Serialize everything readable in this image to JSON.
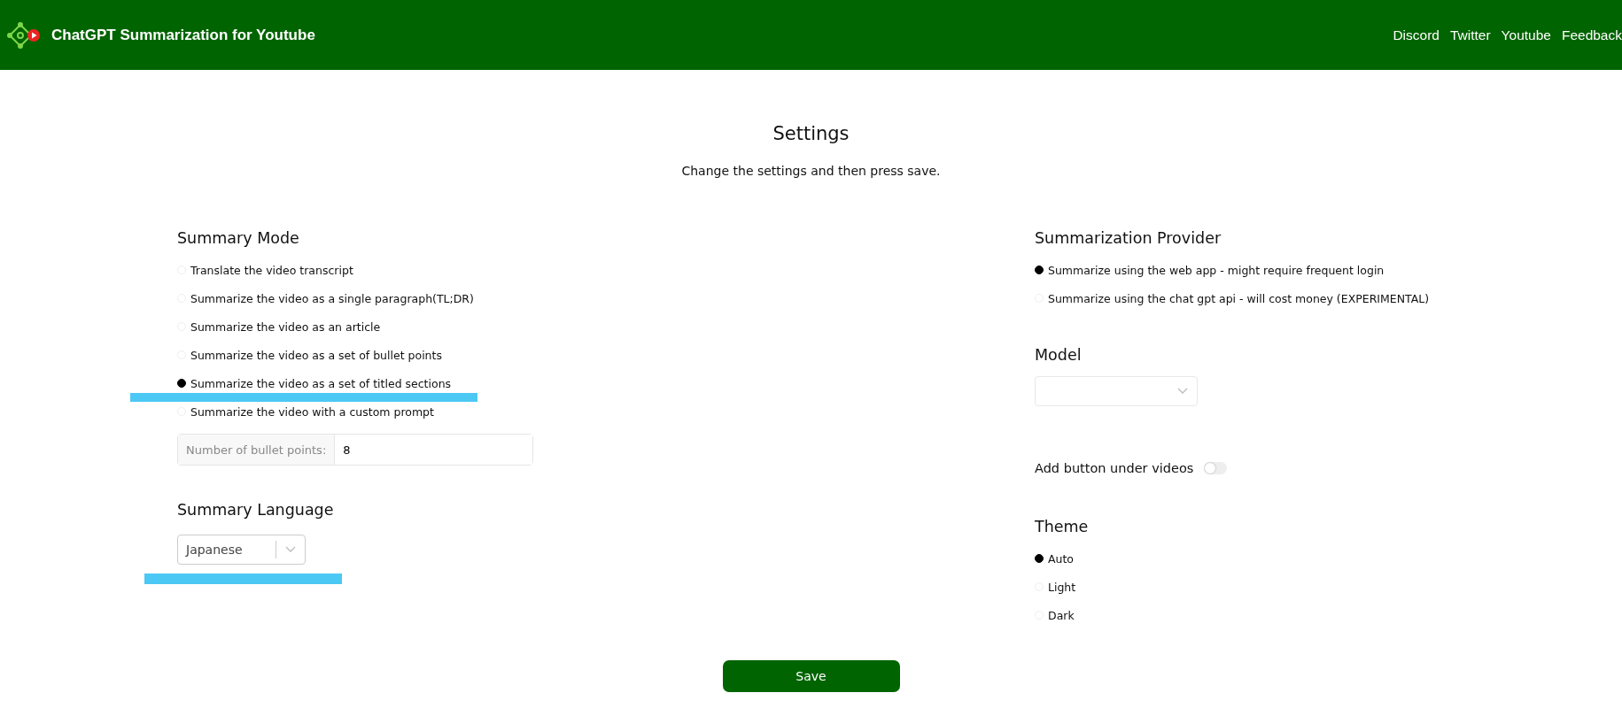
{
  "header": {
    "title": "ChatGPT Summarization for Youtube",
    "nav_links": [
      "Discord",
      "Twitter",
      "Youtube",
      "Feedback"
    ]
  },
  "settings": {
    "title": "Settings",
    "subtitle": "Change the settings and then press save."
  },
  "summary_mode": {
    "heading": "Summary Mode",
    "options": [
      {
        "label": "Translate the video transcript",
        "selected": false
      },
      {
        "label": "Summarize the video as a single paragraph(TL;DR)",
        "selected": false
      },
      {
        "label": "Summarize the video as an article",
        "selected": false
      },
      {
        "label": "Summarize the video as a set of bullet points",
        "selected": false
      },
      {
        "label": "Summarize the video as a set of titled sections",
        "selected": true
      },
      {
        "label": "Summarize the video with a custom prompt",
        "selected": false
      }
    ],
    "bullet_points": {
      "label": "Number of bullet points:",
      "value": "8"
    }
  },
  "summary_language": {
    "heading": "Summary Language",
    "value": "Japanese"
  },
  "provider": {
    "heading": "Summarization Provider",
    "options": [
      {
        "label": "Summarize using the web app - might require frequent login",
        "selected": true
      },
      {
        "label": "Summarize using the chat gpt api - will cost money (EXPERIMENTAL)",
        "selected": false
      }
    ]
  },
  "model": {
    "heading": "Model"
  },
  "add_button": {
    "label": "Add button under videos",
    "on": false
  },
  "theme": {
    "heading": "Theme",
    "options": [
      {
        "label": "Auto",
        "selected": true
      },
      {
        "label": "Light",
        "selected": false
      },
      {
        "label": "Dark",
        "selected": false
      }
    ]
  },
  "save_button": {
    "label": "Save"
  }
}
